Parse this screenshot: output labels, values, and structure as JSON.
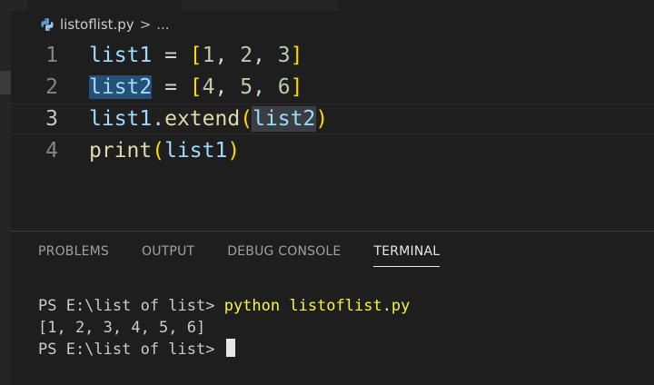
{
  "breadcrumb": {
    "file": "listoflist.py",
    "separator": ">",
    "more": "..."
  },
  "editor": {
    "lines": [
      {
        "number": "1",
        "code": "list1 = [1, 2, 3]"
      },
      {
        "number": "2",
        "code": "list2 = [4, 5, 6]"
      },
      {
        "number": "3",
        "code": "list1.extend(list2)"
      },
      {
        "number": "4",
        "code": "print(list1)"
      }
    ],
    "tokens": {
      "l1_var": "list1",
      "l1_eq": " = ",
      "l1_ob": "[",
      "l1_a": "1",
      "l1_c1": ", ",
      "l1_b": "2",
      "l1_c2": ", ",
      "l1_c": "3",
      "l1_cb": "]",
      "l2_var": "list2",
      "l2_eq": " = ",
      "l2_ob": "[",
      "l2_a": "4",
      "l2_c1": ", ",
      "l2_b": "5",
      "l2_c2": ", ",
      "l2_c": "6",
      "l2_cb": "]",
      "l3_var": "list1",
      "l3_dot": ".",
      "l3_fn": "extend",
      "l3_op": "(",
      "l3_arg": "list2",
      "l3_cp": ")",
      "l4_fn": "print",
      "l4_op": "(",
      "l4_arg": "list1",
      "l4_cp": ")"
    }
  },
  "panel": {
    "tabs": [
      "PROBLEMS",
      "OUTPUT",
      "DEBUG CONSOLE",
      "TERMINAL"
    ],
    "active_tab": "TERMINAL"
  },
  "terminal": {
    "prompt1": "PS E:\\list of list> ",
    "command": "python listoflist.py",
    "output": "[1, 2, 3, 4, 5, 6]",
    "prompt2": "PS E:\\list of list> "
  },
  "colors": {
    "background": "#1e1e1e",
    "variable": "#9cdcfe",
    "function": "#dcdcaa",
    "number": "#b5cea8",
    "bracket": "#ffd700",
    "terminal_command": "#f5f543",
    "selection": "#264f78"
  },
  "icons": {
    "file": "python-file-icon",
    "cursor": "terminal-cursor"
  }
}
